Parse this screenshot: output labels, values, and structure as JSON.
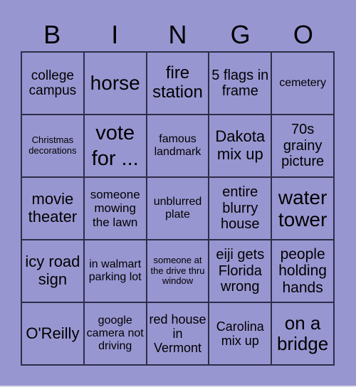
{
  "header": {
    "letters": [
      "B",
      "I",
      "N",
      "G",
      "O"
    ]
  },
  "board": {
    "rows": [
      [
        "college campus",
        "horse",
        "fire station",
        "5 flags in frame",
        "cemetery"
      ],
      [
        "Christmas decorations",
        "vote for ...",
        "famous landmark",
        "Dakota mix up",
        "70s grainy picture"
      ],
      [
        "movie theater",
        "someone mowing the lawn",
        "unblurred plate",
        "entire blurry house",
        "water tower"
      ],
      [
        "icy road sign",
        "in walmart parking lot",
        "someone at the drive thru window",
        "eiji gets Florida wrong",
        "people holding hands"
      ],
      [
        "O'Reilly",
        "google camera not driving",
        "red house in Vermont",
        "Carolina mix up",
        "on a bridge"
      ]
    ]
  },
  "colors": {
    "background": "#9896d1",
    "grid_line": "#2e2d48",
    "text": "#000000"
  }
}
